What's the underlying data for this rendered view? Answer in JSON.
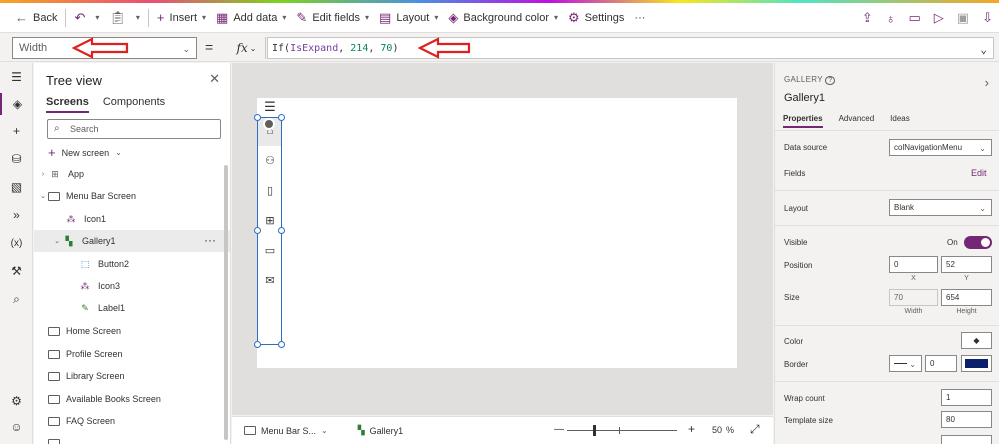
{
  "toolbar": {
    "back": "Back",
    "insert": "Insert",
    "add_data": "Add data",
    "edit_fields": "Edit fields",
    "layout": "Layout",
    "background_color": "Background color",
    "settings": "Settings",
    "more": "···"
  },
  "formula_bar": {
    "property": "Width",
    "equals": "=",
    "fx": "fx",
    "formula": {
      "fn": "If(",
      "arg1": "IsExpand",
      "sep1": ", ",
      "arg2": "214",
      "sep2": ", ",
      "arg3": "70",
      "close": ")"
    }
  },
  "tree_view": {
    "title": "Tree view",
    "tabs": [
      "Screens",
      "Components"
    ],
    "search_placeholder": "Search",
    "new_screen": "New screen",
    "items": [
      {
        "label": "App",
        "level": 0,
        "type": "app",
        "expander": "›"
      },
      {
        "label": "Menu Bar Screen",
        "level": 0,
        "type": "screen",
        "expander": "⌄"
      },
      {
        "label": "Icon1",
        "level": 1,
        "type": "icon"
      },
      {
        "label": "Gallery1",
        "level": 1,
        "type": "gallery",
        "expander": "⌄",
        "selected": true
      },
      {
        "label": "Button2",
        "level": 2,
        "type": "button"
      },
      {
        "label": "Icon3",
        "level": 2,
        "type": "icon"
      },
      {
        "label": "Label1",
        "level": 2,
        "type": "label"
      },
      {
        "label": "Home Screen",
        "level": 0,
        "type": "screen"
      },
      {
        "label": "Profile Screen",
        "level": 0,
        "type": "screen"
      },
      {
        "label": "Library Screen",
        "level": 0,
        "type": "screen"
      },
      {
        "label": "Available Books Screen",
        "level": 0,
        "type": "screen"
      },
      {
        "label": "FAQ Screen",
        "level": 0,
        "type": "screen"
      }
    ]
  },
  "status_bar": {
    "screen": "Menu Bar S...",
    "control": "Gallery1",
    "zoom": "50",
    "zoom_unit": "%",
    "minus": "—",
    "plus": "+"
  },
  "properties": {
    "kind": "GALLERY",
    "name": "Gallery1",
    "tabs": [
      "Properties",
      "Advanced",
      "Ideas"
    ],
    "data_source_label": "Data source",
    "data_source_value": "colNavigationMenu",
    "fields_label": "Fields",
    "fields_edit": "Edit",
    "layout_label": "Layout",
    "layout_value": "Blank",
    "visible_label": "Visible",
    "visible_value": "On",
    "position_label": "Position",
    "x": "0",
    "y": "52",
    "x_cap": "X",
    "y_cap": "Y",
    "size_label": "Size",
    "width": "70",
    "height": "654",
    "width_cap": "Width",
    "height_cap": "Height",
    "color_label": "Color",
    "border_label": "Border",
    "border_width": "0",
    "border_color": "#0b1f6b",
    "wrap_count_label": "Wrap count",
    "wrap_count": "1",
    "template_size_label": "Template size",
    "template_size": "80"
  },
  "colors": {
    "accent": "#742774",
    "annotation_red": "#e02020",
    "selection": "#2b6fc2"
  }
}
